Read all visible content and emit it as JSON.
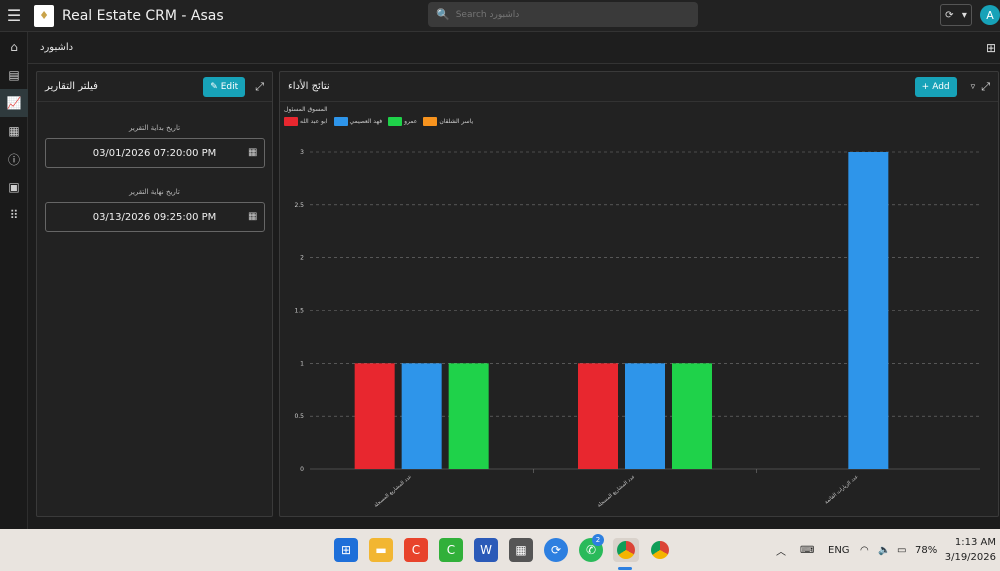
{
  "app": {
    "title": "Real Estate CRM - Asas",
    "avatar_letter": "A"
  },
  "search": {
    "placeholder": "Search داشبورد"
  },
  "breadcrumb": "داشبورد",
  "filter_panel": {
    "title": "فيلتر التقارير",
    "edit_label": "Edit",
    "start_label": "تاريخ بداية التقرير",
    "start_value": "03/01/2026 07:20:00 PM",
    "end_label": "تاريخ نهاية التقرير",
    "end_value": "03/13/2026 09:25:00 PM"
  },
  "chart_panel": {
    "title": "نتائج الأداء",
    "add_label": "Add"
  },
  "chart_data": {
    "type": "bar",
    "legend_title": "المسوق المسئول",
    "legend_position": "top-left",
    "categories": [
      "عدد المشاريع المسجلة",
      "عدد المشاريع المسجلة",
      "عدد الزيارات القائمة"
    ],
    "series": [
      {
        "name": "ابو عبد الله",
        "color": "#e8272f",
        "values": [
          1,
          1,
          0
        ]
      },
      {
        "name": "فهد العصيمي",
        "color": "#2e95ea",
        "values": [
          1,
          1,
          3
        ]
      },
      {
        "name": "عمرو",
        "color": "#1fd24a",
        "values": [
          1,
          1,
          0
        ]
      },
      {
        "name": "ياسر الشلقان",
        "color": "#f7931e",
        "values": [
          0,
          0,
          0
        ]
      }
    ],
    "yticks": [
      "0",
      "0.5",
      "1",
      "1.5",
      "2",
      "2.5",
      "3"
    ],
    "ylim": [
      0,
      3
    ],
    "grid": true
  },
  "taskbar": {
    "whatsapp_badge": "2",
    "lang": "ENG",
    "battery": "78%",
    "time": "1:13 AM",
    "date": "3/19/2026"
  }
}
